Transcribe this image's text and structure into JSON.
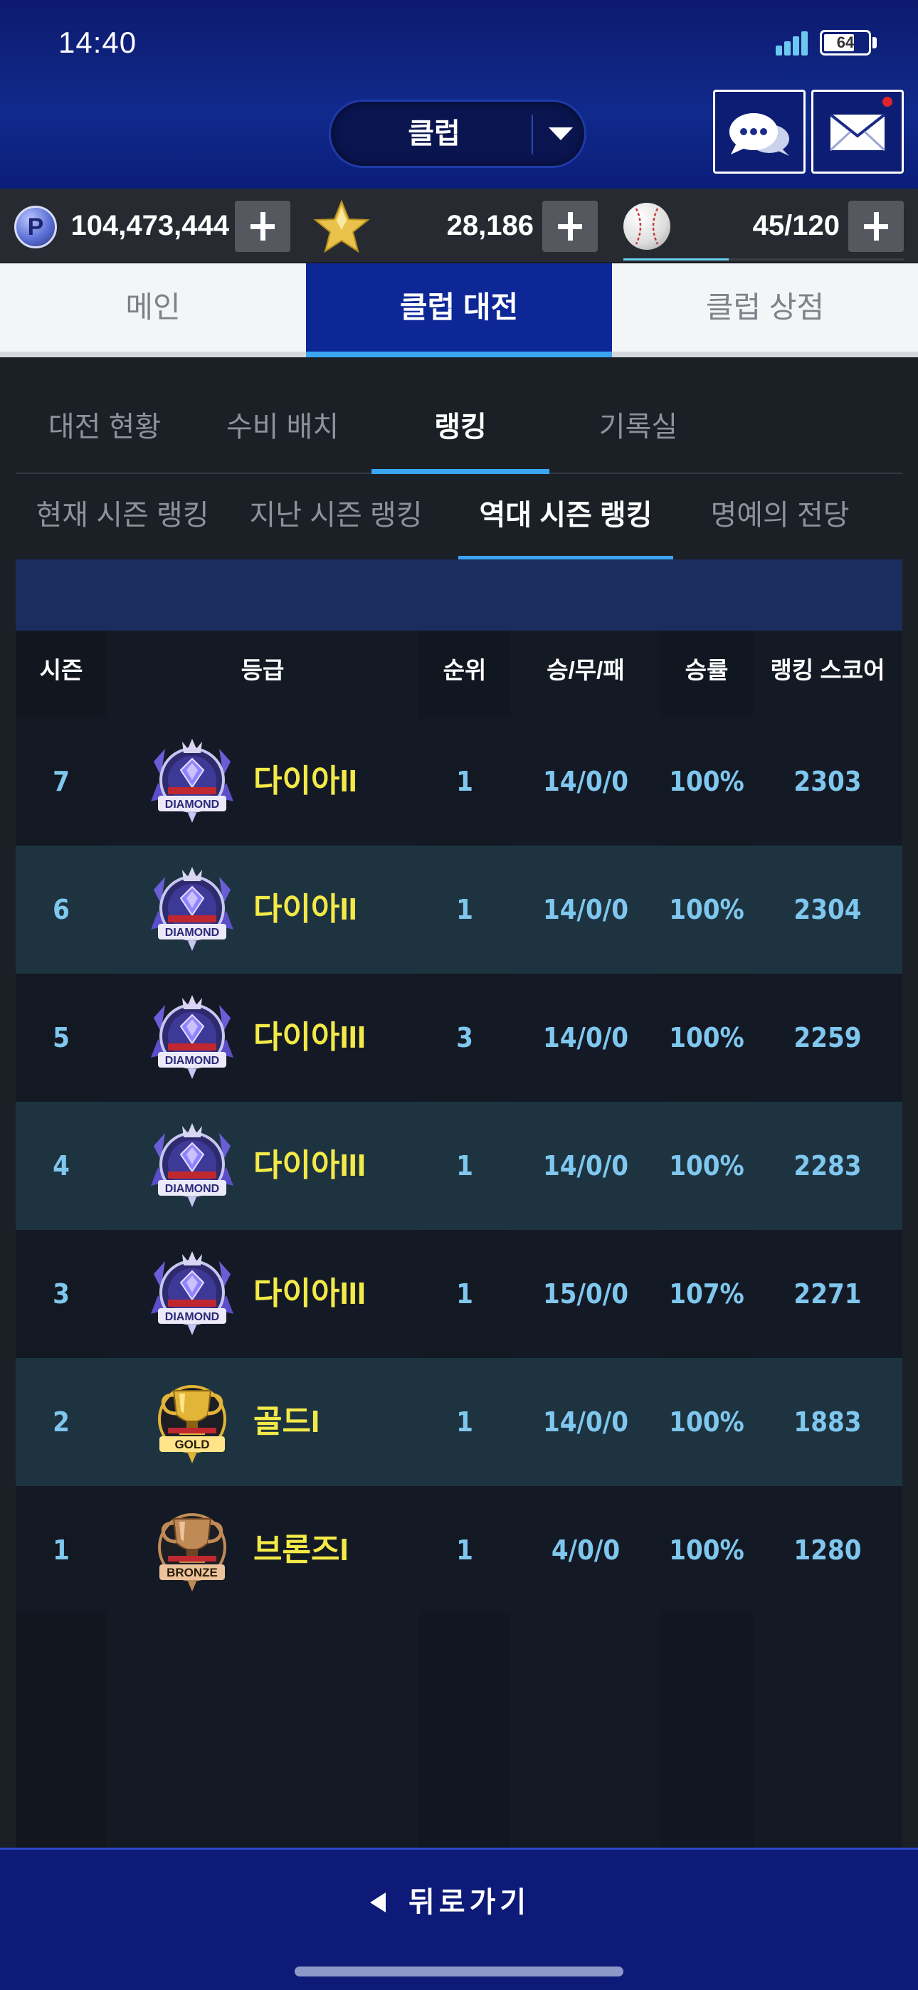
{
  "status": {
    "time": "14:40",
    "battery": "64"
  },
  "header": {
    "club_select_label": "클럽"
  },
  "currency": {
    "points": "104,473,444",
    "points_icon_letter": "P",
    "stars": "28,186",
    "stamina": "45/120",
    "stamina_fraction": 0.375
  },
  "main_tabs": [
    {
      "label": "메인",
      "active": false
    },
    {
      "label": "클럽 대전",
      "active": true
    },
    {
      "label": "클럽 상점",
      "active": false
    }
  ],
  "sub_tabs": [
    {
      "label": "대전 현황",
      "active": false
    },
    {
      "label": "수비 배치",
      "active": false
    },
    {
      "label": "랭킹",
      "active": true
    },
    {
      "label": "기록실",
      "active": false
    }
  ],
  "ranking_tabs": [
    {
      "label": "현재 시즌 랭킹",
      "active": false
    },
    {
      "label": "지난 시즌 랭킹",
      "active": false
    },
    {
      "label": "역대 시즌 랭킹",
      "active": true
    },
    {
      "label": "명예의 전당",
      "active": false
    }
  ],
  "table": {
    "headers": [
      "시즌",
      "등급",
      "순위",
      "승/무/패",
      "승률",
      "랭킹 스코어"
    ],
    "rows": [
      {
        "season": "7",
        "grade": "다이아II",
        "badge": "DIAMOND",
        "badge_icon": "diamond-badge-icon",
        "rank": "1",
        "record": "14/0/0",
        "win_rate": "100%",
        "score": "2303"
      },
      {
        "season": "6",
        "grade": "다이아II",
        "badge": "DIAMOND",
        "badge_icon": "diamond-badge-icon",
        "rank": "1",
        "record": "14/0/0",
        "win_rate": "100%",
        "score": "2304"
      },
      {
        "season": "5",
        "grade": "다이아III",
        "badge": "DIAMOND",
        "badge_icon": "diamond-badge-icon",
        "rank": "3",
        "record": "14/0/0",
        "win_rate": "100%",
        "score": "2259"
      },
      {
        "season": "4",
        "grade": "다이아III",
        "badge": "DIAMOND",
        "badge_icon": "diamond-badge-icon",
        "rank": "1",
        "record": "14/0/0",
        "win_rate": "100%",
        "score": "2283"
      },
      {
        "season": "3",
        "grade": "다이아III",
        "badge": "DIAMOND",
        "badge_icon": "diamond-badge-icon",
        "rank": "1",
        "record": "15/0/0",
        "win_rate": "107%",
        "score": "2271"
      },
      {
        "season": "2",
        "grade": "골드I",
        "badge": "GOLD",
        "badge_icon": "gold-badge-icon",
        "rank": "1",
        "record": "14/0/0",
        "win_rate": "100%",
        "score": "1883"
      },
      {
        "season": "1",
        "grade": "브론즈I",
        "badge": "BRONZE",
        "badge_icon": "bronze-badge-icon",
        "rank": "1",
        "record": "4/0/0",
        "win_rate": "100%",
        "score": "1280"
      }
    ]
  },
  "bottom": {
    "back_label": "뒤로가기"
  },
  "colors": {
    "accent": "#3aa5f2",
    "header_blue": "#0d2796",
    "grade_text": "#f3ea48",
    "cell_text": "#7fc7ee",
    "diamond": "#8f83ff",
    "gold": "#e2b437",
    "bronze": "#c08a57"
  }
}
